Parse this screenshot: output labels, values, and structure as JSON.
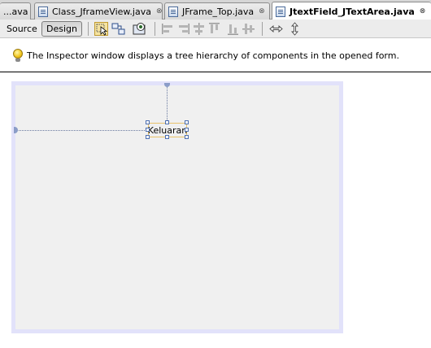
{
  "tabs": [
    {
      "label": "...ava",
      "active": false,
      "closable": false
    },
    {
      "label": "Class_JframeView.java",
      "active": false,
      "closable": true
    },
    {
      "label": "JFrame_Top.java",
      "active": false,
      "closable": true
    },
    {
      "label": "JtextField_JTextArea.java",
      "active": true,
      "closable": true
    }
  ],
  "tab_close_glyph": "⊗",
  "toolbar": {
    "source_label": "Source",
    "design_label": "Design",
    "active_view": "Design"
  },
  "hint": {
    "text": "The Inspector window displays a tree hierarchy of components in the opened form."
  },
  "form": {
    "component_label": "Keluaran"
  },
  "colors": {
    "tab_bar": "#d6d6d6",
    "toolbar": "#ececec",
    "frame_border": "#e2e2fa",
    "frame_bg": "#f0f0f0",
    "selection_border": "#e8c26b",
    "handle": "#4d6fb0"
  }
}
